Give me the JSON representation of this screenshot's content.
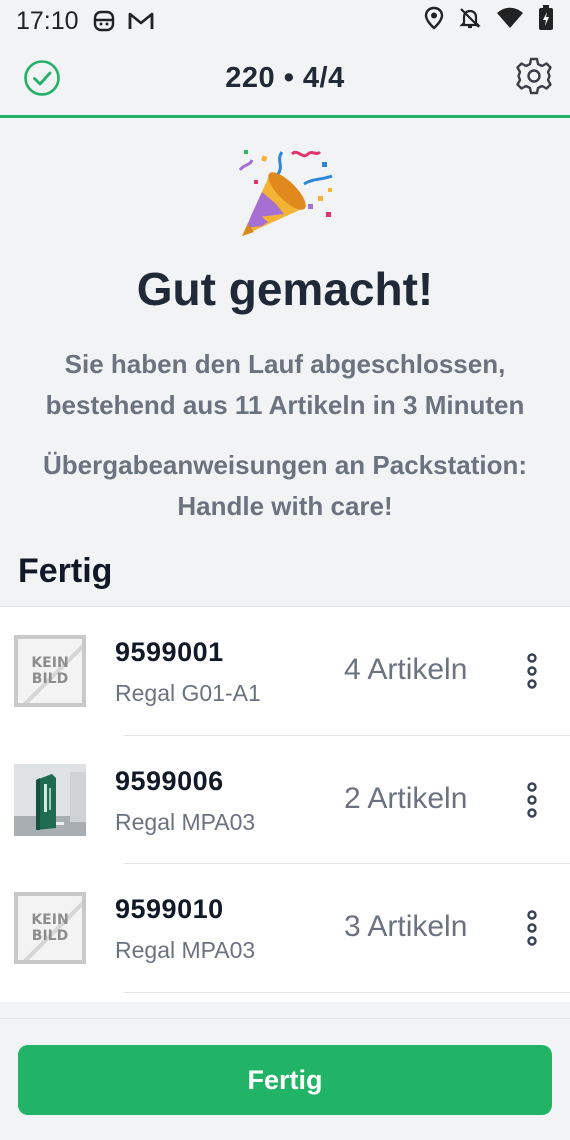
{
  "status_bar": {
    "time": "17:10",
    "icons": [
      "sim-face-icon",
      "gmail-icon",
      "location-icon",
      "bell-off-icon",
      "wifi-icon",
      "battery-charging-icon"
    ]
  },
  "app_bar": {
    "title": "220 • 4/4",
    "left_icon": "check-circle-icon",
    "right_icon": "gear-icon"
  },
  "colors": {
    "accent": "#22b168",
    "button": "#21b466",
    "text_dark": "#1f2937",
    "text_muted": "#6b7280"
  },
  "hero": {
    "icon": "party-popper-icon",
    "headline": "Gut gemacht!",
    "summary_line1": "Sie haben den Lauf abgeschlossen,",
    "summary_line2": "bestehend aus 11 Artikeln in 3 Minuten",
    "handover_line1": "Übergabeanweisungen an Packstation:",
    "handover_line2": "Handle with care!"
  },
  "section_title": "Fertig",
  "items": [
    {
      "code": "9599001",
      "location": "Regal G01-A1",
      "quantity": "4 Artikeln",
      "image": "no-image",
      "no_image_line1": "KEIN",
      "no_image_line2": "BILD"
    },
    {
      "code": "9599006",
      "location": "Regal MPA03",
      "quantity": "2 Artikeln",
      "image": "product-photo"
    },
    {
      "code": "9599010",
      "location": "Regal MPA03",
      "quantity": "3 Artikeln",
      "image": "no-image",
      "no_image_line1": "KEIN",
      "no_image_line2": "BILD"
    }
  ],
  "footer": {
    "button_label": "Fertig"
  }
}
